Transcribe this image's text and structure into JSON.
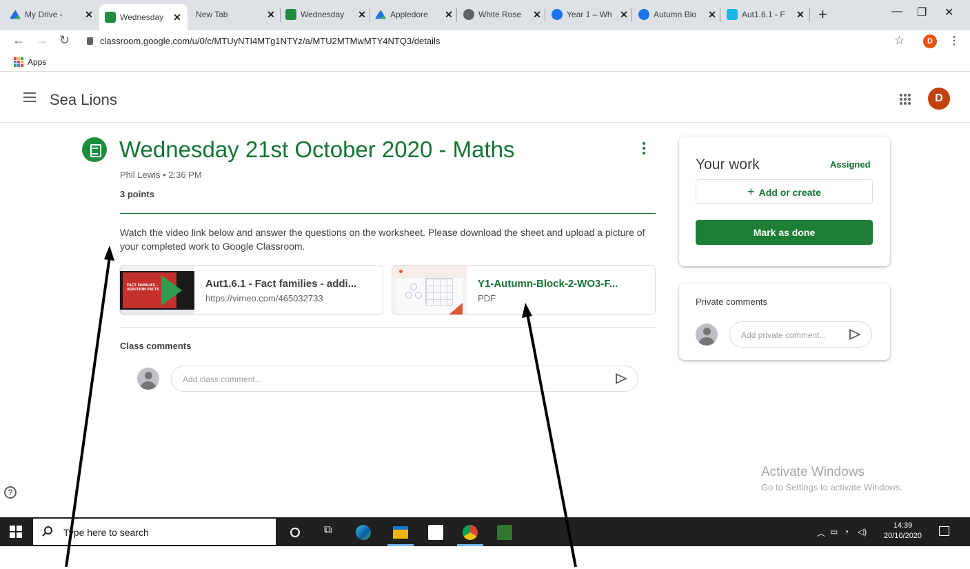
{
  "browser": {
    "tabs": [
      {
        "label": "My Drive - ",
        "color": "#1aa260"
      },
      {
        "label": "Wednesday",
        "color": "#1e8e3e"
      },
      {
        "label": "New Tab",
        "color": ""
      },
      {
        "label": "Wednesday",
        "color": "#1e8e3e"
      },
      {
        "label": "Appledore",
        "color": "#1aa260"
      },
      {
        "label": "White Rose",
        "color": "#5f6368"
      },
      {
        "label": "Year 1 – Wh",
        "color": "#1a73e8"
      },
      {
        "label": "Autumn Blo",
        "color": "#1a73e8"
      },
      {
        "label": "Aut1.6.1 - F",
        "color": "#1ab7ea"
      }
    ],
    "url": "classroom.google.com/u/0/c/MTUyNTI4MTg1NTYz/a/MTU2MTMwMTY4NTQ3/details",
    "bookmarks_apps_label": "Apps",
    "profile_initial": "D"
  },
  "classroom": {
    "class_name": "Sea Lions",
    "user_initial": "D"
  },
  "assignment": {
    "title": "Wednesday 21st October 2020 - Maths",
    "author_time": "Phil Lewis • 2:36 PM",
    "points": "3 points",
    "description": "Watch the video link below and answer the questions on the worksheet. Please download the sheet and upload a picture of your completed work to Google Classroom.",
    "attachments": [
      {
        "title": "Aut1.6.1 - Fact families - addi...",
        "subtitle": "https://vimeo.com/465032733",
        "thumb_text": "FACT FAMILIES - ADDITION FACTS"
      },
      {
        "title": "Y1-Autumn-Block-2-WO3-F...",
        "subtitle": "PDF"
      }
    ],
    "class_comments_label": "Class comments",
    "class_comment_placeholder": "Add class comment..."
  },
  "your_work": {
    "title": "Your work",
    "status": "Assigned",
    "add_label": "Add or create",
    "mark_done_label": "Mark as done"
  },
  "private_comments": {
    "title": "Private comments",
    "placeholder": "Add private comment..."
  },
  "watermark": {
    "line1": "Activate Windows",
    "line2": "Go to Settings to activate Windows."
  },
  "taskbar": {
    "search_placeholder": "Type here to search",
    "time": "14:39",
    "date": "20/10/2020"
  },
  "colors": {
    "classroom_green": "#137333",
    "button_green": "#1e7e34",
    "avatar_orange": "#c2410c"
  }
}
